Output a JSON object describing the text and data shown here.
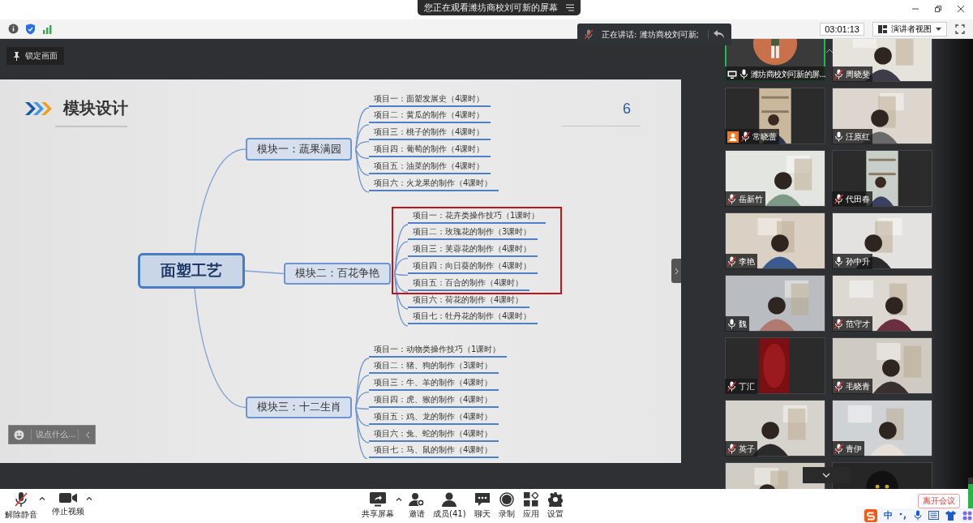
{
  "title_bar": {
    "viewing_label": "您正在观看潍坊商校刘可新的屏幕"
  },
  "info_bar": {
    "timer": "03:01:13",
    "view_mode": "演讲者视图"
  },
  "speaking": {
    "label": "正在讲话: 潍坊商校刘可新;"
  },
  "lock_button": {
    "label": "锁定画面"
  },
  "slide": {
    "title": "模块设计",
    "page": "6",
    "mindmap": {
      "root": "面塑工艺",
      "branches": [
        {
          "label": "模块一：蔬果满园",
          "items": [
            {
              "label": "项目一：面塑发展史（4课时）",
              "highlighted": false
            },
            {
              "label": "项目二：黄瓜的制作（4课时）",
              "highlighted": false
            },
            {
              "label": "项目三：桃子的制作（4课时）",
              "highlighted": false
            },
            {
              "label": "项目四：葡萄的制作（4课时）",
              "highlighted": false
            },
            {
              "label": "项目五：油菜的制作（4课时）",
              "highlighted": false
            },
            {
              "label": "项目六：火龙果的制作（4课时）",
              "highlighted": false
            }
          ]
        },
        {
          "label": "模块二：百花争艳",
          "items": [
            {
              "label": "项目一：花卉类操作技巧（1课时）",
              "highlighted": true
            },
            {
              "label": "项目二：玫瑰花的制作（3课时）",
              "highlighted": true
            },
            {
              "label": "项目三：芙蓉花的制作（4课时）",
              "highlighted": true
            },
            {
              "label": "项目四：向日葵的制作（4课时）",
              "highlighted": true
            },
            {
              "label": "项目五：百合的制作（4课时）",
              "highlighted": true
            },
            {
              "label": "项目六：荷花的制作（4课时）",
              "highlighted": false
            },
            {
              "label": "项目七：牡丹花的制作（4课时）",
              "highlighted": false
            }
          ]
        },
        {
          "label": "模块三：十二生肖",
          "items": [
            {
              "label": "项目一：动物类操作技巧（1课时）",
              "highlighted": false
            },
            {
              "label": "项目二：猪、狗的制作（3课时）",
              "highlighted": false
            },
            {
              "label": "项目三：牛、羊的制作（4课时）",
              "highlighted": false
            },
            {
              "label": "项目四：虎、猴的制作（4课时）",
              "highlighted": false
            },
            {
              "label": "项目五：鸡、龙的制作（4课时）",
              "highlighted": false
            },
            {
              "label": "项目六：兔、蛇的制作（4课时）",
              "highlighted": false
            },
            {
              "label": "项目七：马、鼠的制作（4课时）",
              "highlighted": false
            }
          ]
        }
      ]
    }
  },
  "chat_input": {
    "placeholder": "说点什么..."
  },
  "participants": [
    {
      "name": "潍坊商校刘可新的屏...",
      "kind": "avatar",
      "muted": false,
      "sharing": true,
      "host": false,
      "active": true
    },
    {
      "name": "周晓斐",
      "kind": "camera",
      "muted": true,
      "sharing": false,
      "host": false,
      "active": false
    },
    {
      "name": "常晓蕾",
      "kind": "narrow",
      "muted": true,
      "sharing": false,
      "host": true,
      "active": false
    },
    {
      "name": "汪原红",
      "kind": "camera",
      "muted": false,
      "sharing": false,
      "host": false,
      "active": false
    },
    {
      "name": "岳新竹",
      "kind": "camera",
      "muted": true,
      "sharing": false,
      "host": false,
      "active": false
    },
    {
      "name": "代田春",
      "kind": "narrow",
      "muted": true,
      "sharing": false,
      "host": false,
      "active": false
    },
    {
      "name": "李艳",
      "kind": "camera",
      "muted": true,
      "sharing": false,
      "host": false,
      "active": false
    },
    {
      "name": "孙中升",
      "kind": "camera",
      "muted": false,
      "sharing": false,
      "host": false,
      "active": false
    },
    {
      "name": "魏",
      "kind": "camera",
      "muted": false,
      "sharing": false,
      "host": false,
      "active": false
    },
    {
      "name": "范守才",
      "kind": "camera",
      "muted": true,
      "sharing": false,
      "host": false,
      "active": false
    },
    {
      "name": "丁汇",
      "kind": "blank",
      "muted": true,
      "sharing": false,
      "host": false,
      "active": false
    },
    {
      "name": "毛晓青",
      "kind": "camera",
      "muted": true,
      "sharing": false,
      "host": false,
      "active": false
    },
    {
      "name": "英子",
      "kind": "camera",
      "muted": true,
      "sharing": false,
      "host": false,
      "active": false
    },
    {
      "name": "青伊",
      "kind": "camera",
      "muted": true,
      "sharing": false,
      "host": false,
      "active": false
    },
    {
      "kind": "camera",
      "active": false
    },
    {
      "kind": "orb",
      "active": false
    }
  ],
  "toolbar": {
    "left": [
      {
        "label": "解除静音",
        "kind": "mic",
        "muted": true,
        "menu": true
      },
      {
        "label": "停止视频",
        "kind": "camera",
        "menu": true
      }
    ],
    "center": [
      {
        "label": "共享屏幕",
        "kind": "share",
        "menu": true
      },
      {
        "label": "邀请",
        "kind": "invite",
        "menu": false
      },
      {
        "label": "成员(41)",
        "kind": "members",
        "menu": false
      },
      {
        "label": "聊天",
        "kind": "chat",
        "menu": false
      },
      {
        "label": "录制",
        "kind": "record",
        "menu": false
      },
      {
        "label": "应用",
        "kind": "apps",
        "menu": false
      },
      {
        "label": "设置",
        "kind": "settings",
        "menu": false
      }
    ]
  },
  "leave_button": {
    "label": "离开会议"
  },
  "ime": {
    "mode": "中"
  }
}
